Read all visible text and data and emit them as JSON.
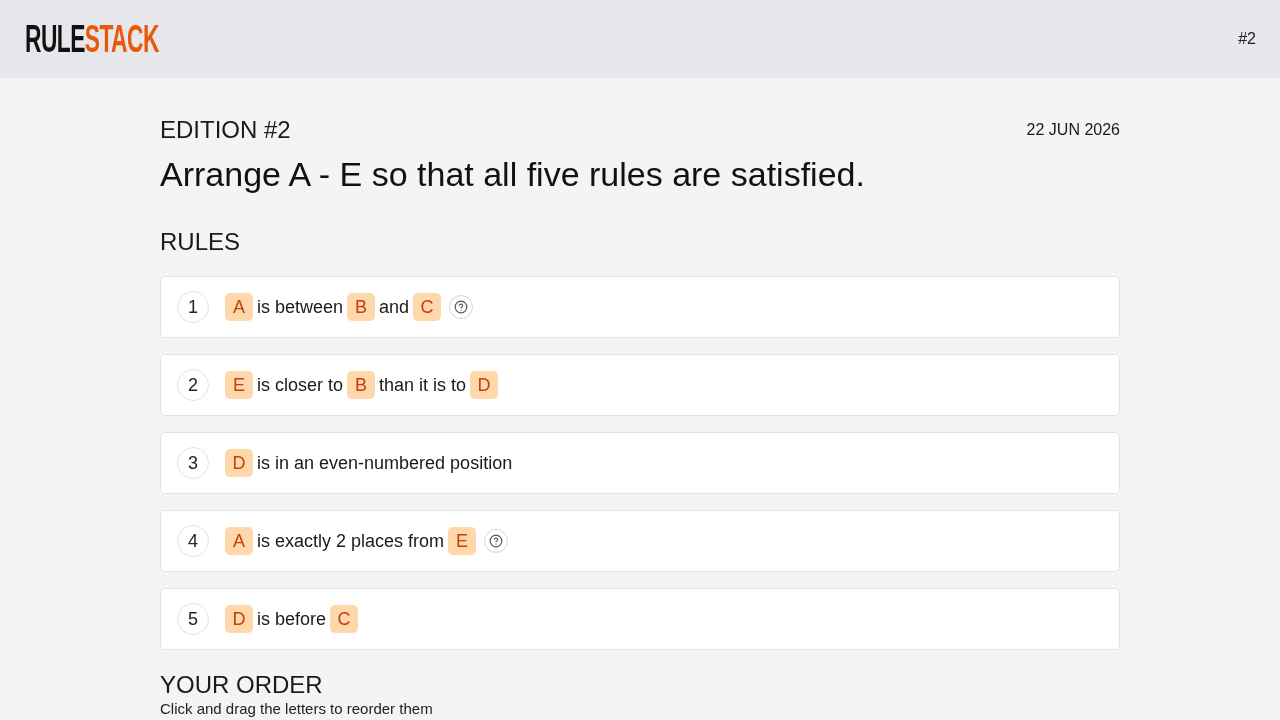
{
  "header": {
    "logo": [
      {
        "text": "RULE",
        "accent": false
      },
      {
        "text": "STACK",
        "accent": true
      }
    ],
    "edition_tag": "#2"
  },
  "puzzle": {
    "edition": "EDITION #2",
    "date": "22 JUN 2026",
    "title": "Arrange A - E so that all five rules are satisfied."
  },
  "rules": {
    "heading": "RULES",
    "items": [
      {
        "number": "1",
        "parts": [
          {
            "kind": "letter",
            "text": "A"
          },
          {
            "kind": "text",
            "text": "is between"
          },
          {
            "kind": "letter",
            "text": "B"
          },
          {
            "kind": "text",
            "text": "and"
          },
          {
            "kind": "letter",
            "text": "C"
          }
        ],
        "help": true
      },
      {
        "number": "2",
        "parts": [
          {
            "kind": "letter",
            "text": "E"
          },
          {
            "kind": "text",
            "text": "is closer to"
          },
          {
            "kind": "letter",
            "text": "B"
          },
          {
            "kind": "text",
            "text": "than it is to"
          },
          {
            "kind": "letter",
            "text": "D"
          }
        ],
        "help": false
      },
      {
        "number": "3",
        "parts": [
          {
            "kind": "letter",
            "text": "D"
          },
          {
            "kind": "text",
            "text": "is in an even-numbered position"
          }
        ],
        "help": false
      },
      {
        "number": "4",
        "parts": [
          {
            "kind": "letter",
            "text": "A"
          },
          {
            "kind": "text",
            "text": "is exactly 2 places from"
          },
          {
            "kind": "letter",
            "text": "E"
          }
        ],
        "help": true
      },
      {
        "number": "5",
        "parts": [
          {
            "kind": "letter",
            "text": "D"
          },
          {
            "kind": "text",
            "text": "is before"
          },
          {
            "kind": "letter",
            "text": "C"
          }
        ],
        "help": false
      }
    ]
  },
  "order": {
    "heading": "YOUR ORDER",
    "instructions": "Click and drag the letters to reorder them"
  }
}
